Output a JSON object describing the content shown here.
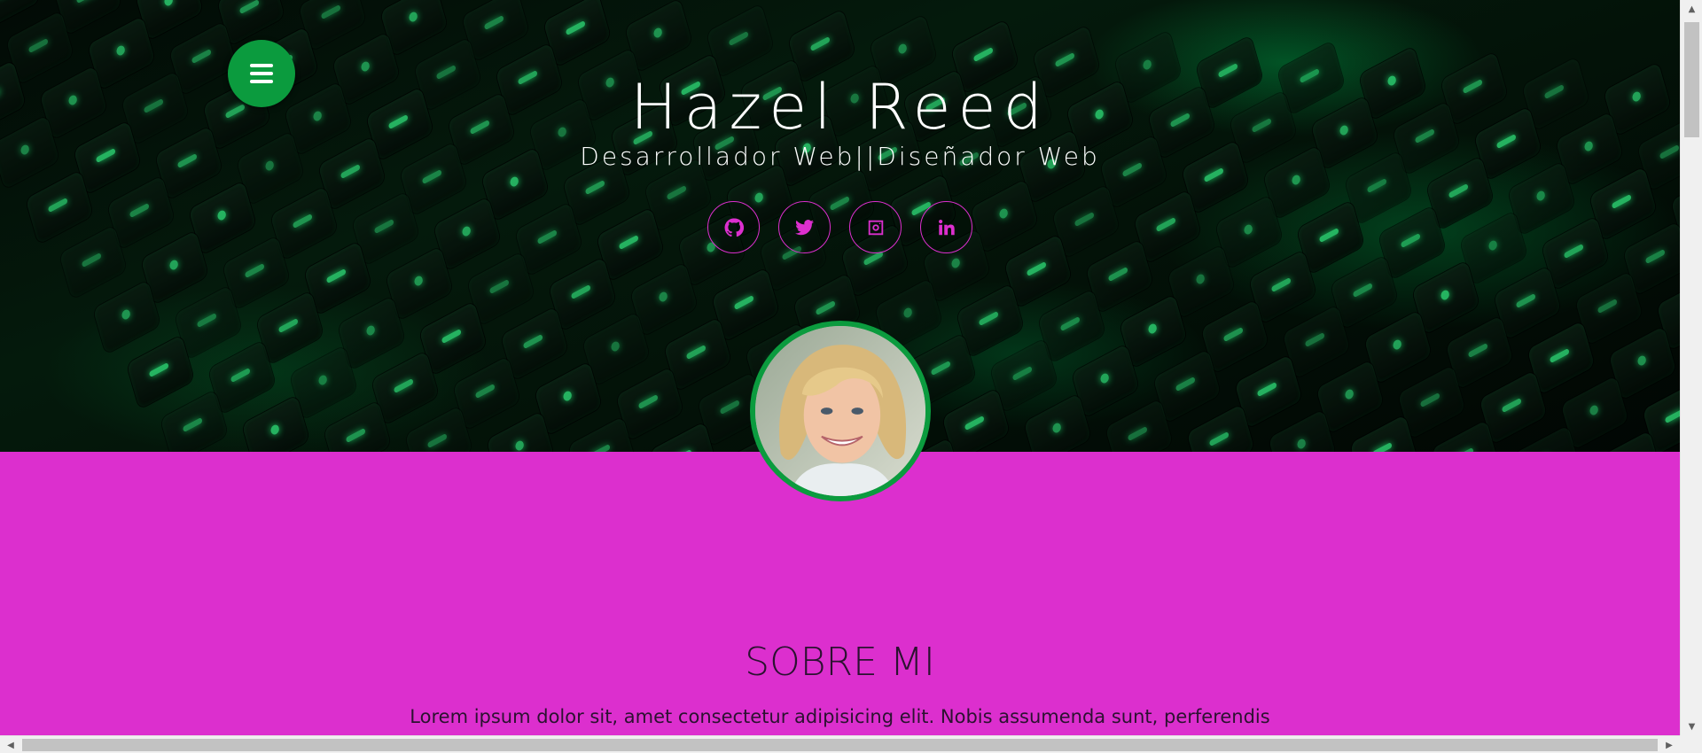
{
  "hero": {
    "name": "Hazel Reed",
    "role": "Desarrollador Web||Diseñador Web",
    "menu_icon": "hamburger-menu-icon",
    "socials": [
      {
        "name": "github",
        "icon": "github-icon"
      },
      {
        "name": "twitter",
        "icon": "twitter-icon"
      },
      {
        "name": "instagram",
        "icon": "instagram-icon"
      },
      {
        "name": "linkedin",
        "icon": "linkedin-icon"
      }
    ]
  },
  "about": {
    "title": "SOBRE MI",
    "text": "Lorem ipsum dolor sit, amet consectetur adipisicing elit. Nobis assumenda sunt, perferendis"
  },
  "colors": {
    "accent_pink": "#dc2fce",
    "accent_green": "#0b9b3e",
    "text_dark": "#2b1230",
    "hero_text": "#ffffff"
  }
}
